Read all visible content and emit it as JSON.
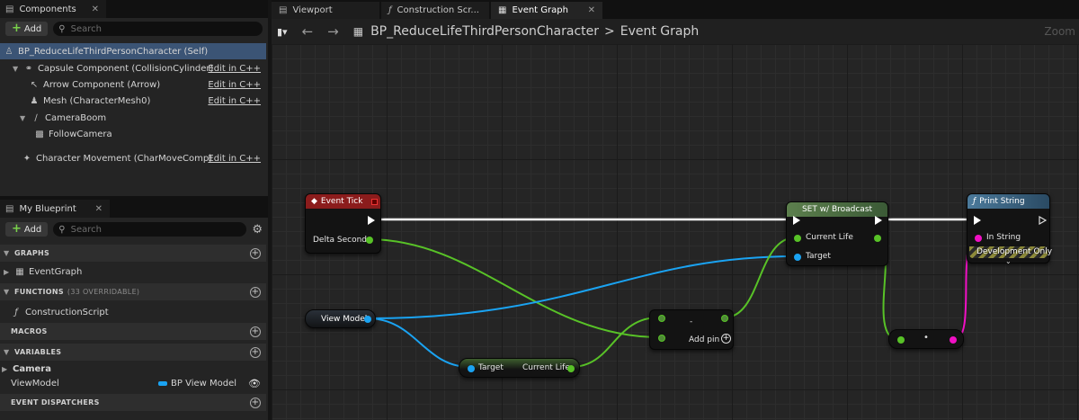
{
  "components_panel": {
    "tab_label": "Components",
    "add_label": "Add",
    "search_placeholder": "Search",
    "items": [
      {
        "label": "BP_ReduceLifeThirdPersonCharacter (Self)",
        "edit": ""
      },
      {
        "label": "Capsule Component (CollisionCylinder)",
        "edit": "Edit in C++"
      },
      {
        "label": "Arrow Component (Arrow)",
        "edit": "Edit in C++"
      },
      {
        "label": "Mesh (CharacterMesh0)",
        "edit": "Edit in C++"
      },
      {
        "label": "CameraBoom",
        "edit": ""
      },
      {
        "label": "FollowCamera",
        "edit": ""
      },
      {
        "label": "Character Movement (CharMoveComp)",
        "edit": "Edit in C++"
      }
    ]
  },
  "my_blueprint_panel": {
    "tab_label": "My Blueprint",
    "add_label": "Add",
    "search_placeholder": "Search",
    "sections": {
      "graphs": "GRAPHS",
      "functions": "FUNCTIONS",
      "functions_sub": "(33 OVERRIDABLE)",
      "macros": "MACROS",
      "variables": "VARIABLES",
      "event_dispatchers": "EVENT DISPATCHERS"
    },
    "graph_item": "EventGraph",
    "function_item": "ConstructionScript",
    "variable_category": "Camera",
    "variable_name": "ViewModel",
    "variable_type": "BP View Model",
    "colors": {
      "object_pin": "#1aa3f2"
    }
  },
  "editor": {
    "tabs": [
      {
        "label": "Viewport"
      },
      {
        "label": "Construction Scr..."
      },
      {
        "label": "Event Graph"
      }
    ],
    "breadcrumb_blueprint": "BP_ReduceLifeThirdPersonCharacter",
    "breadcrumb_separator": ">",
    "breadcrumb_graph": "Event Graph",
    "zoom_label": "Zoom"
  },
  "nodes": {
    "event_tick": {
      "title": "Event Tick",
      "pin_delta": "Delta Seconds"
    },
    "set_broadcast": {
      "title": "SET w/ Broadcast",
      "pin_current_life": "Current Life",
      "pin_target": "Target"
    },
    "print_string": {
      "title": "Print String",
      "pin_in_string": "In String",
      "dev_only": "Development Only"
    },
    "view_model": {
      "label": "View Model"
    },
    "get_current_life": {
      "pin_target": "Target",
      "pin_current_life": "Current Life"
    },
    "subtract": {
      "symbol": "-",
      "add_pin": "Add pin"
    },
    "convert": {
      "symbol": "•"
    }
  },
  "colors": {
    "float_pin": "#58c227",
    "object_pin": "#1aa3f2",
    "string_pin": "#f010c4",
    "event_header": "#8b1c1c",
    "set_header": "#3b5a36",
    "print_header": "#2a4a63",
    "selection": "#3b5475"
  }
}
